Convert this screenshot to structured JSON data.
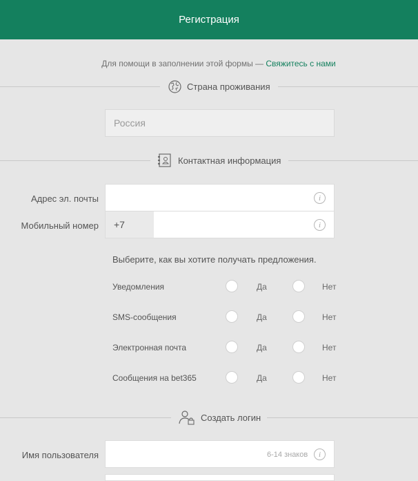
{
  "header": {
    "title": "Регистрация"
  },
  "help": {
    "text": "Для помощи в заполнении этой формы — ",
    "link": "Свяжитесь с нами"
  },
  "sections": {
    "country": {
      "title": "Страна проживания",
      "icon": "globe-icon"
    },
    "contact": {
      "title": "Контактная информация",
      "icon": "address-book-icon"
    },
    "login": {
      "title": "Создать логин",
      "icon": "user-lock-icon"
    }
  },
  "country": {
    "value": "Россия"
  },
  "contact": {
    "email_label": "Адрес эл. почты",
    "mobile_label": "Мобильный номер",
    "mobile_prefix": "+7",
    "info_glyph": "i"
  },
  "preferences": {
    "title": "Выберите, как вы хотите получать предложения.",
    "yes": "Да",
    "no": "Нет",
    "items": [
      {
        "label": "Уведомления"
      },
      {
        "label": "SMS-сообщения"
      },
      {
        "label": "Электронная почта"
      },
      {
        "label": "Сообщения на bet365"
      }
    ]
  },
  "login": {
    "username_label": "Имя пользователя",
    "username_hint": "6-14 знаков"
  },
  "colors": {
    "brand": "#14805e",
    "background": "#e6e6e6"
  }
}
